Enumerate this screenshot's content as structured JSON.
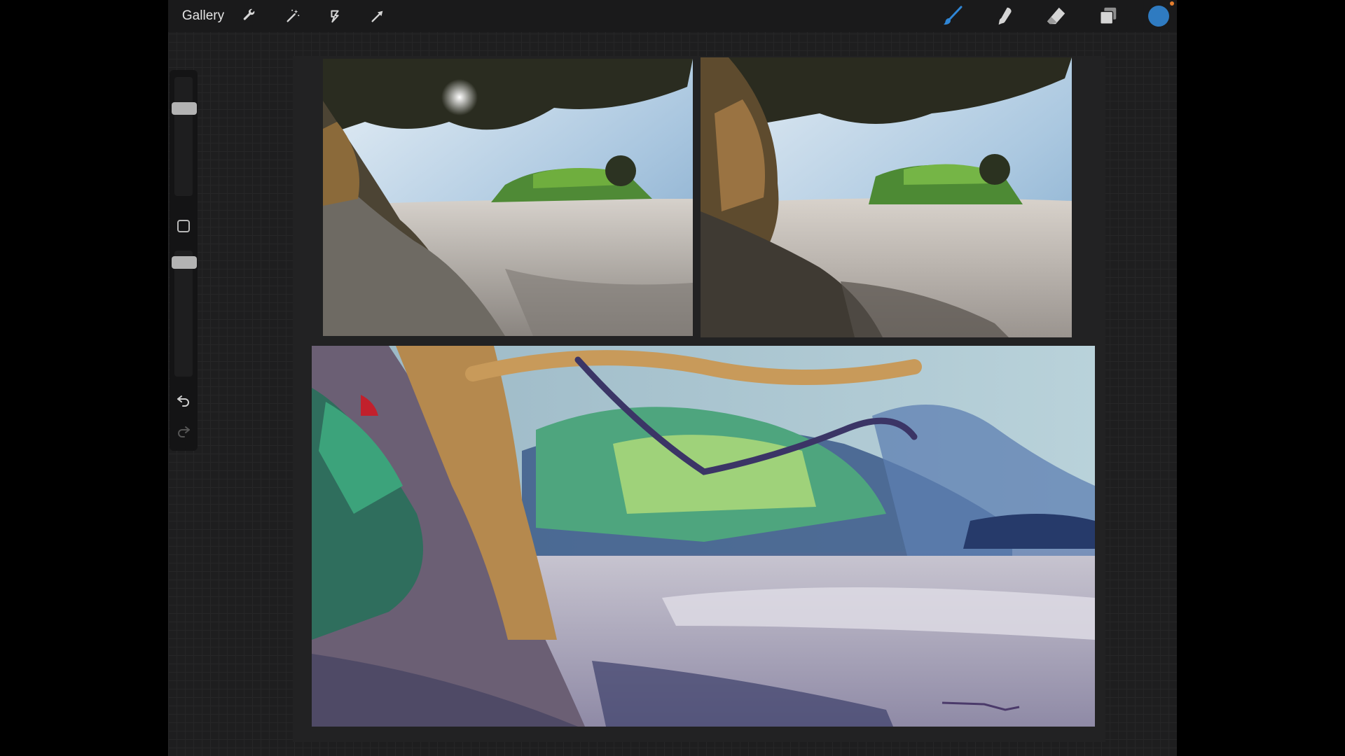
{
  "toolbar": {
    "gallery_label": "Gallery",
    "left_tools": [
      "wrench-icon",
      "magic-wand-icon",
      "selection-icon",
      "transform-arrow-icon"
    ],
    "right_tools": [
      "brush-icon",
      "smudge-icon",
      "eraser-icon",
      "layers-icon"
    ],
    "active_tool": "brush",
    "current_color": "#2f7bc1",
    "accent_color": "#e67f2e"
  },
  "sidebar": {
    "brush_size": 0.78,
    "brush_opacity": 0.95,
    "controls": [
      "size-slider",
      "modify-button",
      "opacity-slider",
      "undo-icon",
      "redo-icon"
    ]
  },
  "canvas": {
    "images": [
      "reference-photo-beach-left",
      "reference-photo-beach-right",
      "gouache-painting-beach-tree"
    ]
  }
}
